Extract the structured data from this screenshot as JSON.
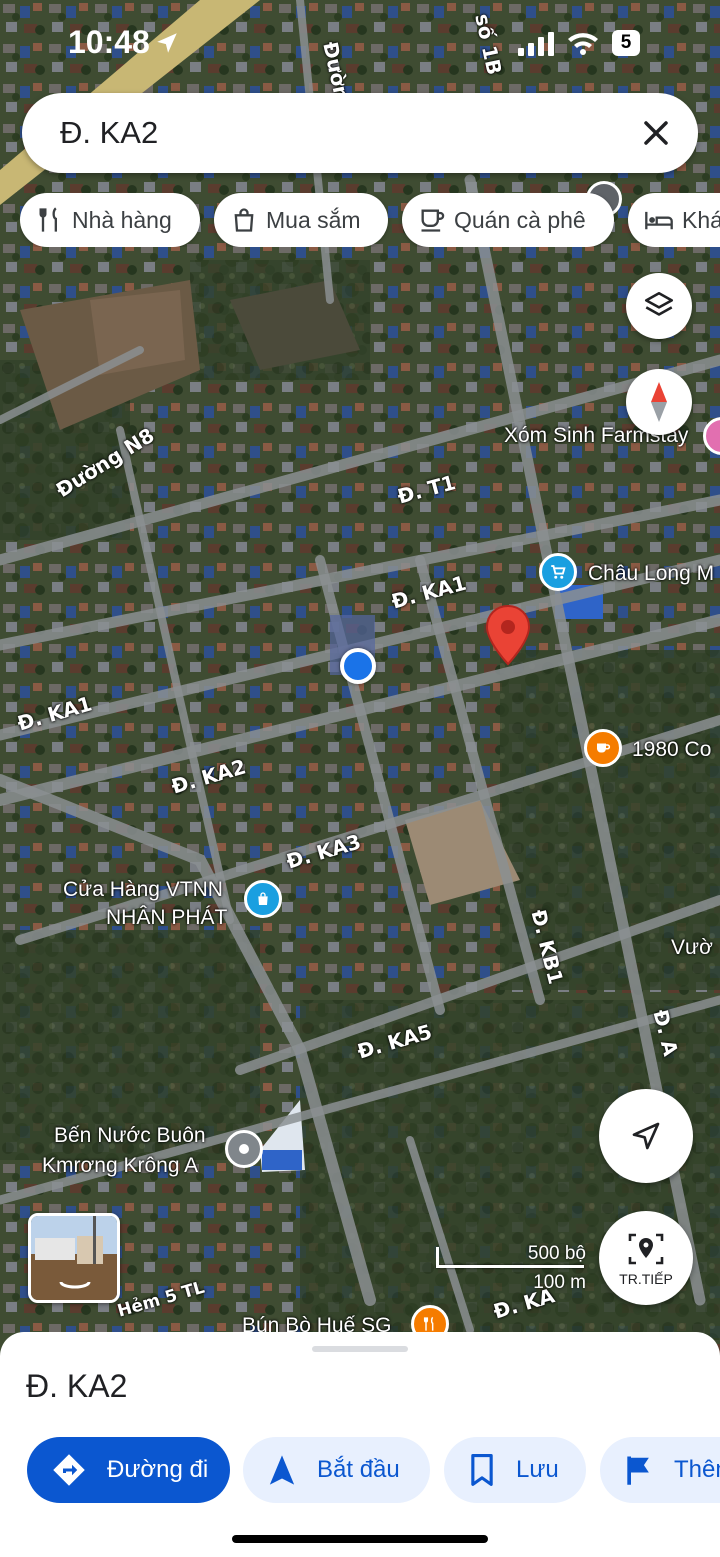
{
  "status_bar": {
    "time": "10:48",
    "battery": "5"
  },
  "search": {
    "query": "Đ. KA2"
  },
  "chips": [
    {
      "label": "Nhà hàng",
      "icon": "restaurant-icon"
    },
    {
      "label": "Mua sắm",
      "icon": "shopping-bag-icon"
    },
    {
      "label": "Quán cà phê",
      "icon": "coffee-icon"
    },
    {
      "label": "Khá",
      "icon": "hotel-bed-icon"
    }
  ],
  "map": {
    "street_labels": [
      "Đường N8",
      "Đ. T1",
      "Đ. KA1",
      "Đ. KA1",
      "Đ. KA2",
      "Đ. KA3",
      "Đ. KA5",
      "Đ. KB1",
      "Đ. A",
      "Hẻm 5 TL",
      "Đ. KA",
      "Đường",
      "số 1B"
    ],
    "poi": {
      "farmstay": "Xóm Sinh Farmstay",
      "chau_long": "Châu Long M",
      "coffee_1980": "1980 Co",
      "cua_hang_line1": "Cửa Hàng VTNN",
      "cua_hang_line2": "NHÂN PHÁT",
      "vuon": "Vườ",
      "ben_nuoc_line1": "Bến Nước Buôn",
      "ben_nuoc_line2": "Kmrơng Krông A",
      "bun_bo": "Bún Bò Huế SG"
    },
    "scale_imperial": "500 bộ",
    "scale_metric": "100 m",
    "streetview_label": "TR.TIẾP"
  },
  "sheet": {
    "place_name": "Đ. KA2",
    "buttons": {
      "directions": "Đường đi",
      "start": "Bắt đầu",
      "save": "Lưu",
      "more": "Thêm"
    }
  },
  "colors": {
    "accent": "#0b57d0",
    "pin_red": "#ea4335",
    "location_blue": "#1a73e8",
    "coffee_orange": "#f57c00",
    "shop_blue": "#1a9fe0"
  }
}
